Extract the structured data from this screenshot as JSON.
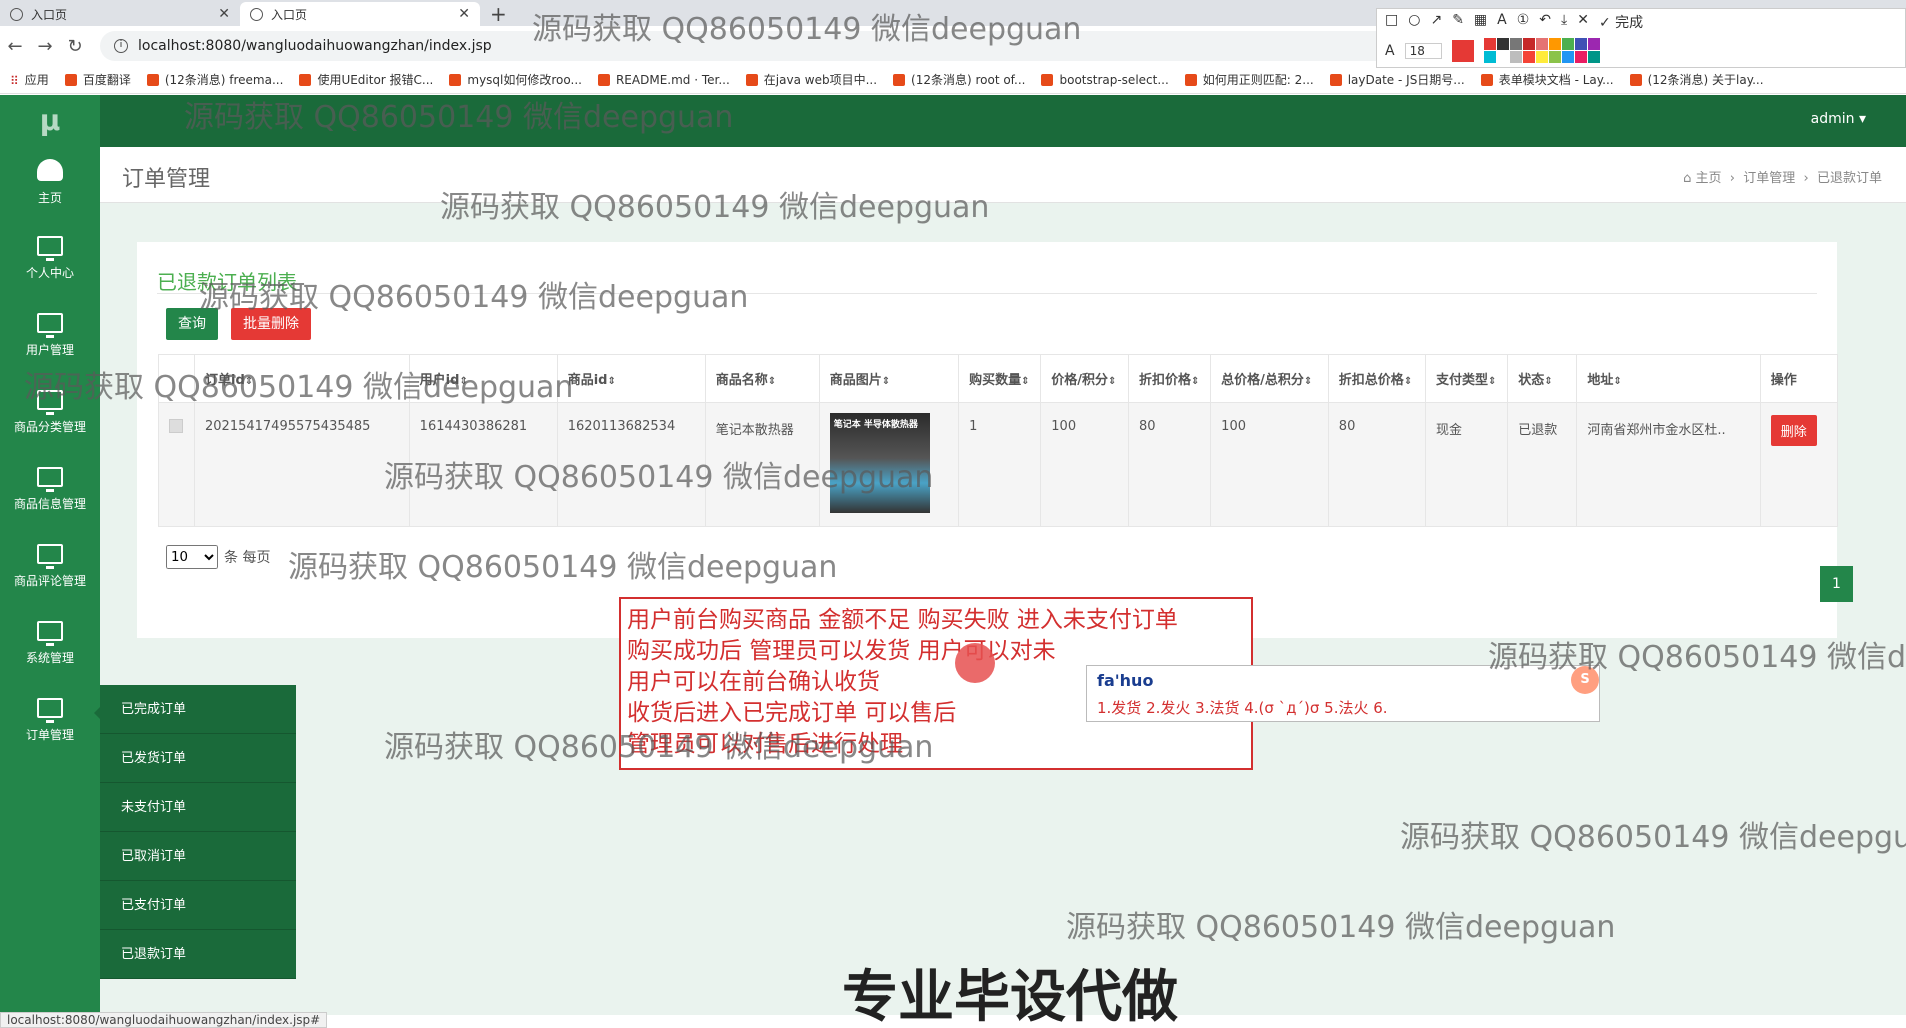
{
  "browser": {
    "tabs": [
      {
        "title": "入口页"
      },
      {
        "title": "入口页"
      }
    ],
    "url": "localhost:8080/wangluodaihuowangzhan/index.jsp",
    "bookmarks": [
      "应用",
      "百度翻译",
      "(12条消息) freema...",
      "使用UEditor 报错C...",
      "mysql如何修改roo...",
      "README.md · Ter...",
      "在java web项目中...",
      "(12条消息) root of...",
      "bootstrap-select...",
      "如何用正则匹配: 2...",
      "layDate - JS日期号...",
      "表单模块文档 - Lay...",
      "(12条消息) 关于lay..."
    ],
    "status_url": "localhost:8080/wangluodaihuowangzhan/index.jsp#"
  },
  "shot_tool": {
    "font_size": "18",
    "done_label": "完成",
    "colors": [
      "#e53935",
      "#333333",
      "#777777",
      "#c62828",
      "#e57373",
      "#ff9800",
      "#4caf50",
      "#3f51b5",
      "#9c27b0",
      "#00bcd4",
      "#ffffff",
      "#bdbdbd",
      "#f44336",
      "#ffeb3b",
      "#8bc34a",
      "#2196f3",
      "#e91e63",
      "#009688"
    ]
  },
  "app": {
    "logo": "μ",
    "user": "admin ▾",
    "sidebar": [
      {
        "label": "主页",
        "icon": "dashboard-icon"
      },
      {
        "label": "个人中心",
        "icon": "monitor-icon"
      },
      {
        "label": "用户管理",
        "icon": "monitor-icon"
      },
      {
        "label": "商品分类管理",
        "icon": "monitor-icon"
      },
      {
        "label": "商品信息管理",
        "icon": "monitor-icon"
      },
      {
        "label": "商品评论管理",
        "icon": "monitor-icon"
      },
      {
        "label": "系统管理",
        "icon": "monitor-icon"
      },
      {
        "label": "订单管理",
        "icon": "monitor-icon"
      }
    ],
    "submenu": [
      "已完成订单",
      "已发货订单",
      "未支付订单",
      "已取消订单",
      "已支付订单",
      "已退款订单"
    ],
    "page_title": "订单管理",
    "breadcrumb": [
      "主页",
      "订单管理",
      "已退款订单"
    ],
    "list_title": "已退款订单列表",
    "buttons": {
      "query": "查询",
      "batch_delete": "批量删除"
    },
    "table": {
      "headers": [
        "订单id",
        "用户id",
        "商品id",
        "商品名称",
        "商品图片",
        "购买数量",
        "价格/积分",
        "折扣价格",
        "总价格/总积分",
        "折扣总价格",
        "支付类型",
        "状态",
        "地址",
        "操作"
      ],
      "rows": [
        {
          "order_id": "20215417495575435485",
          "user_id": "1614430386281",
          "product_id": "1620113682534",
          "product_name": "笔记本散热器",
          "image_caption": "笔记本 半导体散热器",
          "quantity": "1",
          "price": "100",
          "discount_price": "80",
          "total": "100",
          "discount_total": "80",
          "pay_type": "现金",
          "status": "已退款",
          "address": "河南省郑州市金水区杜..",
          "action": "删除"
        }
      ]
    },
    "pager": {
      "page_size": "10",
      "per_page_label": "条 每页",
      "current_page": "1"
    }
  },
  "annotation": [
    "用户前台购买商品 金额不足 购买失败 进入未支付订单",
    "购买成功后  管理员可以发货  用户可以对未",
    "用户可以在前台确认收货",
    "收货后进入已完成订单 可以售后",
    "管理员可以对售后进行处理"
  ],
  "ime": {
    "input": "fa'huo",
    "candidates": "1.发货  2.发火  3.法货  4.(σ ˋдˊ)σ  5.法火  6."
  },
  "watermark_text": "源码获取 QQ86050149 微信deepguan",
  "caption": "专业毕设代做"
}
